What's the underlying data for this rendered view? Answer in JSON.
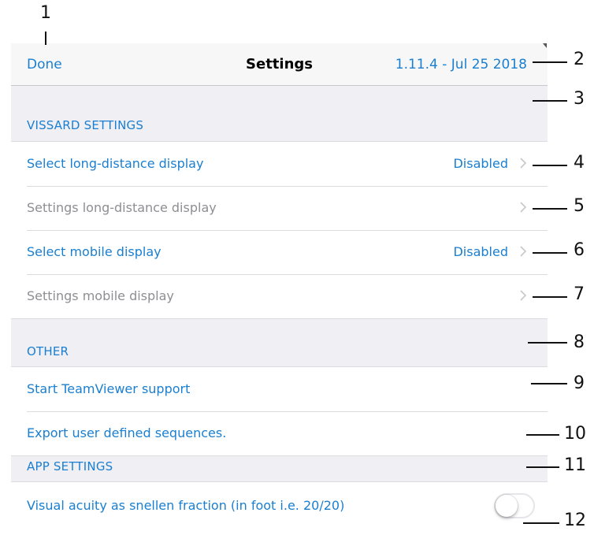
{
  "navbar": {
    "done_label": "Done",
    "title": "Settings",
    "version": "1.11.4 - Jul 25 2018"
  },
  "sections": {
    "vissard": {
      "header": "VISSARD SETTINGS",
      "rows": [
        {
          "label": "Select long-distance display",
          "value": "Disabled"
        },
        {
          "label": "Settings long-distance display"
        },
        {
          "label": "Select mobile display",
          "value": "Disabled"
        },
        {
          "label": "Settings mobile display"
        }
      ]
    },
    "other": {
      "header": "OTHER",
      "rows": [
        {
          "label": "Start TeamViewer support"
        },
        {
          "label": "Export user defined sequences."
        }
      ]
    },
    "app": {
      "header": "APP SETTINGS",
      "rows": [
        {
          "label": "Visual acuity as snellen fraction (in foot i.e. 20/20)",
          "toggle_on": false
        }
      ]
    }
  },
  "callouts": [
    "1",
    "2",
    "3",
    "4",
    "5",
    "6",
    "7",
    "8",
    "9",
    "10",
    "11",
    "12"
  ],
  "colors": {
    "accent": "#1a7fd0",
    "disabled_text": "#8e8e93",
    "grouped_background": "#efeff4"
  },
  "icons": {
    "row_disclosure": "chevron-right-icon"
  }
}
